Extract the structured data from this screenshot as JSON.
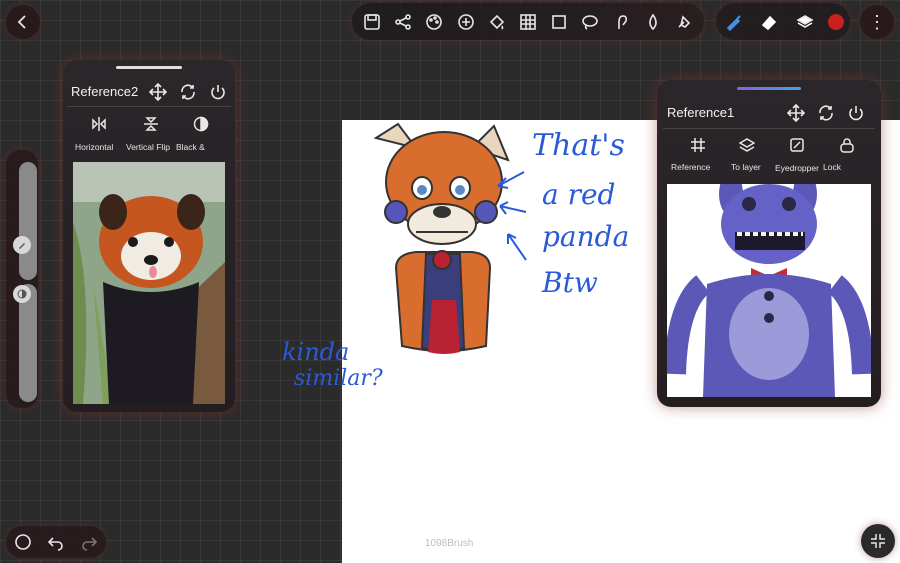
{
  "toolbar": {
    "icons": [
      "save-icon",
      "share-icon",
      "palette-icon",
      "add-icon",
      "fill-icon",
      "grid-icon",
      "crop-icon",
      "lasso-icon",
      "smudge-icon",
      "blur-icon",
      "liquify-icon"
    ]
  },
  "right_tools": {
    "icons": [
      "brush-icon",
      "eraser-icon",
      "layers-icon"
    ],
    "current_color": "#c8201e",
    "brush_color": "#4a90e2"
  },
  "reference2": {
    "title": "Reference2",
    "tools": [
      {
        "label": "Horizontal",
        "icon": "flip-horizontal-icon"
      },
      {
        "label": "Vertical Flip",
        "icon": "flip-vertical-icon"
      },
      {
        "label": "Black &",
        "icon": "black-white-icon"
      }
    ]
  },
  "reference1": {
    "title": "Reference1",
    "tools": [
      {
        "label": "Reference",
        "icon": "reference-grid-icon"
      },
      {
        "label": "To layer",
        "icon": "to-layer-icon"
      },
      {
        "label": "Eyedropper",
        "icon": "eyedropper-icon"
      },
      {
        "label": "Lock",
        "icon": "lock-icon"
      }
    ]
  },
  "canvas": {
    "annotation_right": [
      "That's",
      "a red",
      "panda",
      "Btw"
    ],
    "annotation_left": [
      "kinda",
      "similar?"
    ],
    "brush_name": "1098Brush"
  }
}
